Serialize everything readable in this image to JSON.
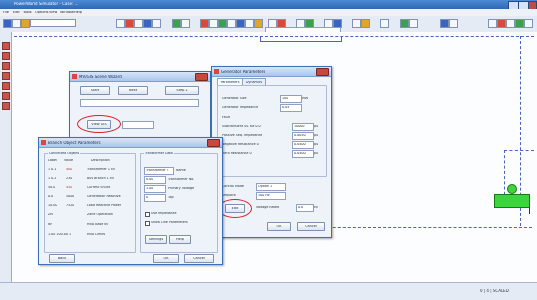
{
  "app": {
    "title": "PowerWorld Simulator - Case: ...",
    "menu": [
      "File",
      "Edit",
      "Tools",
      "Options",
      "View",
      "Window",
      "Help"
    ],
    "status": "0   | 4 | SCALED"
  },
  "dialog_wizard": {
    "title": "MV/GIS Scene Wizard",
    "tabs": [
      "Start",
      "Next",
      "Step 2"
    ],
    "view_gis_button": "View GIS",
    "field_value": ""
  },
  "dialog_generator": {
    "title": "Generator Parameters",
    "tabs": [
      "Parameters",
      "Dynamics"
    ],
    "rows": [
      {
        "label": "Generator Size",
        "value": "100",
        "unit": "MW"
      },
      {
        "label": "Generator Impedance",
        "value": "0.05",
        "unit": ""
      },
      {
        "label": "Fault",
        "value": "",
        "unit": ""
      },
      {
        "label": "Subtransient Ss. Kd 0.0",
        "value": "10000",
        "unit": "pu"
      },
      {
        "label": "Positive Seq. Impedance",
        "value": "0.0050",
        "unit": "pu"
      },
      {
        "label": "Negative Resistance 0",
        "value": "0.0400",
        "unit": "pu"
      },
      {
        "label": "Zero Resistance 0",
        "value": "0.0400",
        "unit": "pu"
      }
    ],
    "lower_rows": [
      {
        "label": "Control Mode",
        "value": "Option 1"
      },
      {
        "label": "Setpoint",
        "value": "100 Hz"
      },
      {
        "label": "Voltage Rated",
        "value": "0.0",
        "unit": "kV"
      }
    ],
    "edit_button": "Edit",
    "ok_button": "OK",
    "cancel_button": "Cancel"
  },
  "dialog_object": {
    "title": "Branch Object Parameters",
    "group_left_title": "Connected Objects",
    "header_cols": [
      "Label",
      "Value",
      "Description"
    ],
    "rows": [
      {
        "id": "1 0.1",
        "v": "400",
        "desc": "Transformer 1 kV"
      },
      {
        "id": "1 0.2",
        "v": "230",
        "desc": "Bus Branch 1 kV"
      },
      {
        "id": "50.0",
        "v": "450",
        "desc": "Current Shunt"
      },
      {
        "id": "0.0",
        "v": "5000",
        "desc": "Generation Reactive"
      },
      {
        "id": "10.00",
        "v": "7520",
        "desc": "Load Reactive Power"
      },
      {
        "id": "ZN",
        "v": "",
        "desc": "Zone Operation"
      },
      {
        "id": "NF",
        "v": "",
        "desc": "MVA Base kv"
      },
      {
        "id": "1.00 100.00 1",
        "v": "",
        "desc": "MVA Limits"
      }
    ],
    "group_right_title": "Transformer Data",
    "right_fields": [
      {
        "label": "Name",
        "value": "Transformer T"
      },
      {
        "label": "Transformer No.",
        "value": "0.00"
      },
      {
        "label": "Primary Voltage",
        "value": "1.00"
      },
      {
        "label": "Tap",
        "value": "0"
      }
    ],
    "check1": "Use Impedance",
    "check2": "Show Line Parameters",
    "settings_button": "Settings",
    "help_button": "Help",
    "back_button": "Back",
    "ok_button": "OK",
    "cancel_button": "Cancel"
  },
  "colors": {
    "accent": "#3c6fb8",
    "annotation": "#d9232a",
    "node": "#3bd43b"
  }
}
